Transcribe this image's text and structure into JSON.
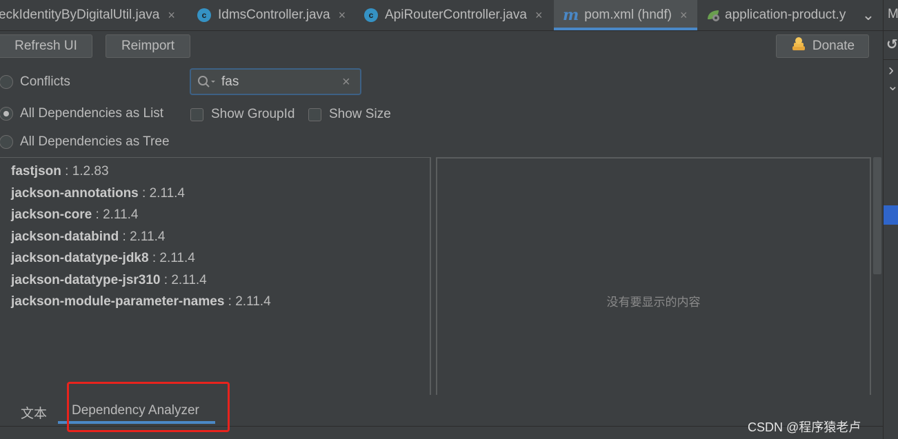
{
  "tabs": [
    {
      "label": "eckIdentityByDigitalUtil.java",
      "icon": "class-icon",
      "close": "×"
    },
    {
      "label": "IdmsController.java",
      "icon": "class-icon",
      "close": "×"
    },
    {
      "label": "ApiRouterController.java",
      "icon": "class-icon",
      "close": "×"
    },
    {
      "label": "pom.xml (hndf)",
      "icon": "maven-icon",
      "close": "×",
      "active": true
    },
    {
      "label": "application-product.y",
      "icon": "spring-leaf-icon"
    }
  ],
  "tab_glyphs": {
    "class": "c",
    "maven": "m",
    "overflow": "⌄"
  },
  "toolbar": {
    "refresh_label": "Refresh UI",
    "reimport_label": "Reimport",
    "donate_label": "Donate"
  },
  "options": {
    "conflicts": "Conflicts",
    "list": "All Dependencies as List",
    "tree": "All Dependencies as Tree",
    "selected": "list"
  },
  "search": {
    "value": "fas",
    "clear": "×"
  },
  "checkboxes": {
    "show_groupid": "Show GroupId",
    "show_size": "Show Size"
  },
  "dependencies": [
    {
      "name": "fastjson",
      "version": " : 1.2.83"
    },
    {
      "name": "jackson-annotations",
      "version": " : 2.11.4"
    },
    {
      "name": "jackson-core",
      "version": " : 2.11.4"
    },
    {
      "name": "jackson-databind",
      "version": " : 2.11.4"
    },
    {
      "name": "jackson-datatype-jdk8",
      "version": " : 2.11.4"
    },
    {
      "name": "jackson-datatype-jsr310",
      "version": " : 2.11.4"
    },
    {
      "name": "jackson-module-parameter-names",
      "version": " : 2.11.4"
    }
  ],
  "detail": {
    "empty_text": "没有要显示的内容"
  },
  "bottom_tabs": {
    "text": "文本",
    "analyzer": "Dependency Analyzer"
  },
  "gutter": {
    "top_letter": "M",
    "refresh": "↺",
    "chevron1": "›",
    "chevron2": "⌄"
  },
  "watermark": "CSDN @程序猿老卢",
  "colors": {
    "accent": "#4a88c7",
    "highlight_box": "#e8231d",
    "background": "#3c3f41"
  }
}
